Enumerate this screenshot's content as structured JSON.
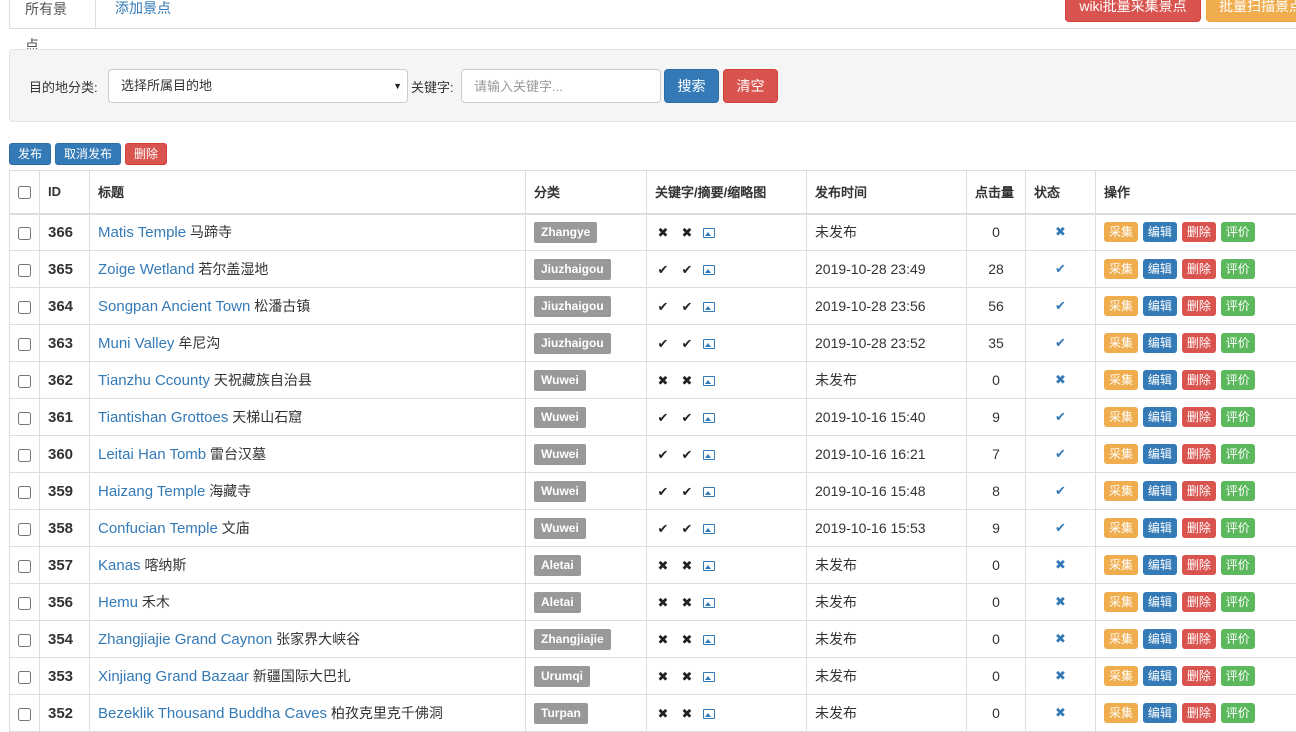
{
  "tabs": {
    "all": "所有景点",
    "add": "添加景点"
  },
  "top_buttons": {
    "wiki": "wiki批量采集景点",
    "scan": "批量扫描景点"
  },
  "filter": {
    "dest_label": "目的地分类:",
    "dest_select": "选择所属目的地",
    "keyword_label": "关键字:",
    "keyword_placeholder": "请输入关键字...",
    "search_btn": "搜索",
    "clear_btn": "清空"
  },
  "bulk": {
    "publish": "发布",
    "unpublish": "取消发布",
    "delete": "删除"
  },
  "headers": {
    "id": "ID",
    "title": "标题",
    "category": "分类",
    "meta": "关键字/摘要/缩略图",
    "time": "发布时间",
    "clicks": "点击量",
    "status": "状态",
    "ops": "操作"
  },
  "ops": {
    "collect": "采集",
    "edit": "编辑",
    "delete": "删除",
    "eval": "评价"
  },
  "rows": [
    {
      "id": "366",
      "title_en": "Matis Temple",
      "title_cn": "马蹄寺",
      "category": "Zhangye",
      "kw": "✖",
      "summary": "✖",
      "time": "未发布",
      "clicks": "0",
      "status": "✖"
    },
    {
      "id": "365",
      "title_en": "Zoige Wetland",
      "title_cn": "若尔盖湿地",
      "category": "Jiuzhaigou",
      "kw": "✔",
      "summary": "✔",
      "time": "2019-10-28 23:49",
      "clicks": "28",
      "status": "✔"
    },
    {
      "id": "364",
      "title_en": "Songpan Ancient Town",
      "title_cn": "松潘古镇",
      "category": "Jiuzhaigou",
      "kw": "✔",
      "summary": "✔",
      "time": "2019-10-28 23:56",
      "clicks": "56",
      "status": "✔"
    },
    {
      "id": "363",
      "title_en": "Muni Valley",
      "title_cn": "牟尼沟",
      "category": "Jiuzhaigou",
      "kw": "✔",
      "summary": "✔",
      "time": "2019-10-28 23:52",
      "clicks": "35",
      "status": "✔"
    },
    {
      "id": "362",
      "title_en": "Tianzhu Ccounty",
      "title_cn": "天祝藏族自治县",
      "category": "Wuwei",
      "kw": "✖",
      "summary": "✖",
      "time": "未发布",
      "clicks": "0",
      "status": "✖"
    },
    {
      "id": "361",
      "title_en": "Tiantishan Grottoes",
      "title_cn": "天梯山石窟",
      "category": "Wuwei",
      "kw": "✔",
      "summary": "✔",
      "time": "2019-10-16 15:40",
      "clicks": "9",
      "status": "✔"
    },
    {
      "id": "360",
      "title_en": "Leitai Han Tomb",
      "title_cn": "雷台汉墓",
      "category": "Wuwei",
      "kw": "✔",
      "summary": "✔",
      "time": "2019-10-16 16:21",
      "clicks": "7",
      "status": "✔"
    },
    {
      "id": "359",
      "title_en": "Haizang Temple",
      "title_cn": "海藏寺",
      "category": "Wuwei",
      "kw": "✔",
      "summary": "✔",
      "time": "2019-10-16 15:48",
      "clicks": "8",
      "status": "✔"
    },
    {
      "id": "358",
      "title_en": "Confucian Temple",
      "title_cn": "文庙",
      "category": "Wuwei",
      "kw": "✔",
      "summary": "✔",
      "time": "2019-10-16 15:53",
      "clicks": "9",
      "status": "✔"
    },
    {
      "id": "357",
      "title_en": "Kanas",
      "title_cn": "喀纳斯",
      "category": "Aletai",
      "kw": "✖",
      "summary": "✖",
      "time": "未发布",
      "clicks": "0",
      "status": "✖"
    },
    {
      "id": "356",
      "title_en": "Hemu",
      "title_cn": "禾木",
      "category": "Aletai",
      "kw": "✖",
      "summary": "✖",
      "time": "未发布",
      "clicks": "0",
      "status": "✖"
    },
    {
      "id": "354",
      "title_en": "Zhangjiajie Grand Caynon",
      "title_cn": "张家界大峡谷",
      "category": "Zhangjiajie",
      "kw": "✖",
      "summary": "✖",
      "time": "未发布",
      "clicks": "0",
      "status": "✖"
    },
    {
      "id": "353",
      "title_en": "Xinjiang Grand Bazaar",
      "title_cn": "新疆国际大巴扎",
      "category": "Urumqi",
      "kw": "✖",
      "summary": "✖",
      "time": "未发布",
      "clicks": "0",
      "status": "✖"
    },
    {
      "id": "352",
      "title_en": "Bezeklik Thousand Buddha Caves",
      "title_cn": "柏孜克里克千佛洞",
      "category": "Turpan",
      "kw": "✖",
      "summary": "✖",
      "time": "未发布",
      "clicks": "0",
      "status": "✖"
    }
  ]
}
